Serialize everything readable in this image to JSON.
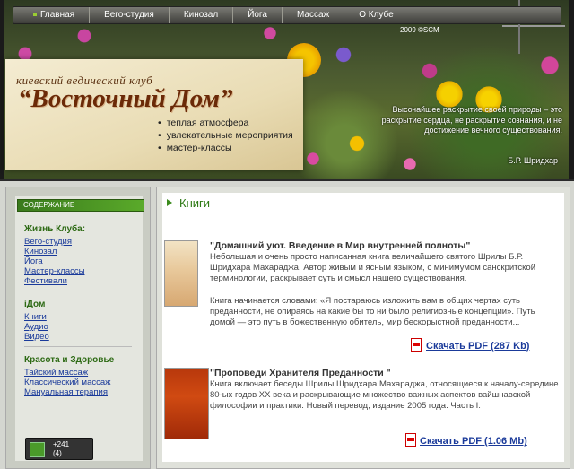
{
  "nav": {
    "items": [
      "Главная",
      "Вего-студия",
      "Кинозал",
      "Йога",
      "Массаж",
      "О Клубе"
    ]
  },
  "header": {
    "year": "2009 ©SCM",
    "club_subtitle": "киевский ведический клуб",
    "club_title": "“Восточный Дом”",
    "features": [
      "теплая атмосфера",
      "увлекательные мероприятия",
      "мастер-классы"
    ],
    "quote": "Высочайшее раскрытие своей природы – это раскрытие сердца, не раскрытие сознания, и не достижение вечного существования.",
    "quote_author": "Б.Р. Шридхар"
  },
  "sidebar": {
    "header": "СОДЕРЖАНИЕ",
    "groups": [
      {
        "title": "Жизнь Клуба:",
        "links": [
          "Вего-студия",
          "Кинозал",
          "Йога",
          "Мастер-классы",
          "Фестивали"
        ]
      },
      {
        "title": "iДом",
        "links": [
          "Книги",
          "Аудио",
          "Видео"
        ]
      },
      {
        "title": "Красота и Здоровье",
        "links": [
          "Тайский массаж",
          "Классический массаж",
          "Мануальная терапия"
        ]
      }
    ]
  },
  "counter": {
    "main": "+241",
    "sub": "(4)"
  },
  "main": {
    "section_title": "Книги",
    "books": [
      {
        "title": "\"Домашний уют. Введение в Мир внутренней полноты\"",
        "paragraph1": "Небольшая и очень просто написанная книга величайшего святого Шрилы Б.Р. Шридхара Махараджа. Автор живым и ясным языком, с минимумом санскритской терминологии, раскрывает суть и смысл нашего существования.",
        "paragraph2": "Книга начинается словами: «Я постараюсь изложить вам в общих чертах суть преданности, не опираясь на какие бы то ни было религиозные концепции». Путь домой — это путь в божественную обитель, мир бескорыстной преданности...",
        "download": "Скачать PDF (287 Kb)"
      },
      {
        "title": "\"Проповеди Хранителя Преданности \"",
        "paragraph1": "Книга включает беседы Шрилы Шридхара Махараджа, относящиеся к началу-середине 80-ых годов XX века и раскрывающие множество важных аспектов вайшнавской философии и практики. Новый перевод, издание 2005 года. Часть I:",
        "download": "Скачать PDF (1.06 Mb)"
      }
    ]
  }
}
